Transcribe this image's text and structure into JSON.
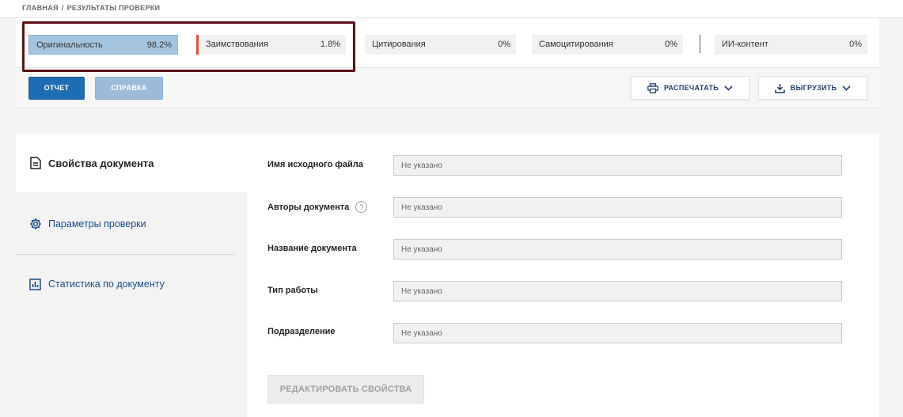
{
  "breadcrumb": {
    "home": "ГЛАВНАЯ",
    "separator": "/",
    "current": "РЕЗУЛЬТАТЫ ПРОВЕРКИ"
  },
  "metrics": [
    {
      "label": "Оригинальность",
      "value": "98.2%"
    },
    {
      "label": "Заимствования",
      "value": "1.8%"
    },
    {
      "label": "Цитирования",
      "value": "0%"
    },
    {
      "label": "Самоцитирования",
      "value": "0%"
    },
    {
      "label": "ИИ-контент",
      "value": "0%"
    }
  ],
  "toolbar": {
    "report_label": "ОТЧЕТ",
    "help_label": "СПРАВКА",
    "print_label": "РАСПЕЧАТАТЬ",
    "export_label": "ВЫГРУЗИТЬ"
  },
  "sidebar": {
    "items": [
      {
        "label": "Свойства документа",
        "icon": "document-icon",
        "active": true
      },
      {
        "label": "Параметры проверки",
        "icon": "gear-icon",
        "active": false
      },
      {
        "label": "Статистика по документу",
        "icon": "chart-icon",
        "active": false
      }
    ]
  },
  "properties": {
    "fields": [
      {
        "label": "Имя исходного файла",
        "value": "Не указано"
      },
      {
        "label": "Авторы документа",
        "value": "Не указано",
        "help": "?"
      },
      {
        "label": "Название документа",
        "value": "Не указано"
      },
      {
        "label": "Тип работы",
        "value": "Не указано"
      },
      {
        "label": "Подразделение",
        "value": "Не указано"
      }
    ],
    "edit_label": "РЕДАКТИРОВАТЬ СВОЙСТВА"
  },
  "colors": {
    "originality_bg": "#a5c4dd",
    "borrow_accent": "#e5532d",
    "primary_button": "#1e6db2",
    "highlight_frame": "#5c1317"
  }
}
